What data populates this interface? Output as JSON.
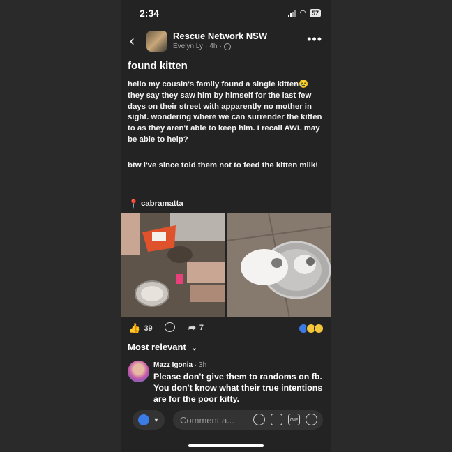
{
  "status_bar": {
    "time": "2:34",
    "battery": "57"
  },
  "header": {
    "page_name": "Rescue Network NSW",
    "author": "Evelyn Ly",
    "time": "4h",
    "separator": "·",
    "back_icon": "chevron-left-icon",
    "more_icon": "ellipsis-icon"
  },
  "post": {
    "title": "found kitten",
    "paragraph1": "hello my cousin's family found a single kitten😢 they say they saw him by himself for the last few days on their street with apparently no mother in sight. wondering where we can surrender the kitten to as they aren't able to keep him. I recall AWL may be able to help?",
    "paragraph2": "btw i've since told them not to feed the kitten milk!",
    "location": "cabramatta"
  },
  "engagement": {
    "likes": "39",
    "shares": "7"
  },
  "comments": {
    "sort_label": "Most relevant",
    "items": [
      {
        "name": "Mazz  Igonia",
        "time": "· 3h",
        "text": "Please don't give them to randoms on fb. You don't know what their true intentions are for the poor kitty."
      }
    ]
  },
  "composer": {
    "placeholder": "Comment a..."
  },
  "colors": {
    "background": "#232323",
    "accent": "#3b7be8",
    "text": "#f0f0f0"
  }
}
